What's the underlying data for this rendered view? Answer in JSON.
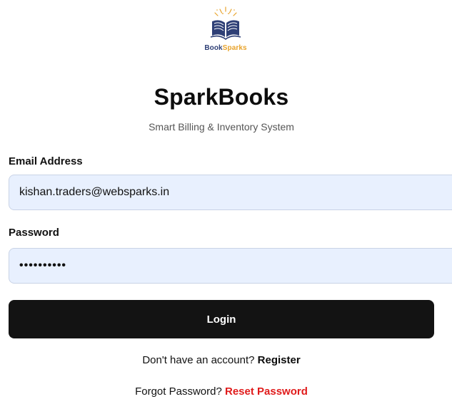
{
  "logo": {
    "text_part1": "Book",
    "text_part2": "Sparks",
    "icon": "open-book-icon"
  },
  "header": {
    "title": "SparkBooks",
    "subtitle": "Smart Billing & Inventory System"
  },
  "form": {
    "email_label": "Email Address",
    "email_value": "kishan.traders@websparks.in",
    "password_label": "Password",
    "password_value": "1234567890",
    "login_label": "Login"
  },
  "footer": {
    "register_prompt": "Don't have an account?",
    "register_link": "Register",
    "reset_prompt": "Forgot Password?",
    "reset_link": "Reset Password"
  },
  "colors": {
    "field_background": "#e8f0fe",
    "button_background": "#131313",
    "reset_link": "#e01b1b",
    "logo_navy": "#2e3f76",
    "logo_gold": "#e8a32b"
  }
}
